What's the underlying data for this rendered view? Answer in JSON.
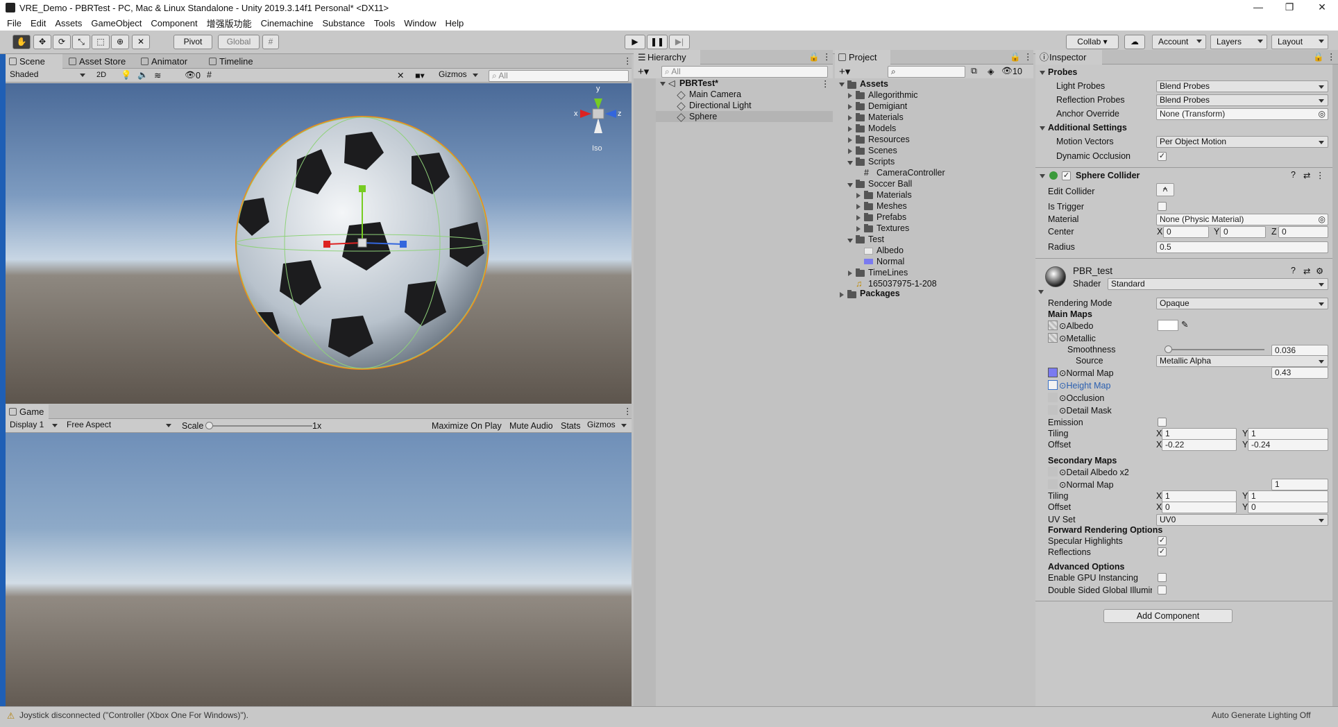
{
  "window": {
    "title": "VRE_Demo - PBRTest - PC, Mac & Linux Standalone - Unity 2019.3.14f1 Personal* <DX11>",
    "minimize": "—",
    "maximize": "❐",
    "close": "✕"
  },
  "menu": [
    "File",
    "Edit",
    "Assets",
    "GameObject",
    "Component",
    "增强版功能",
    "Cinemachine",
    "Substance",
    "Tools",
    "Window",
    "Help"
  ],
  "toolbar": {
    "pivot": "Pivot",
    "global": "Global",
    "collab": "Collab ▾",
    "account": "Account",
    "layers": "Layers",
    "layout": "Layout"
  },
  "scene": {
    "tabs": [
      "Scene",
      "Asset Store",
      "Animator",
      "Timeline"
    ],
    "shading": "Shaded",
    "mode2d": "2D",
    "gizmos": "Gizmos",
    "search_placeholder": "All",
    "hidden_count": "0",
    "axis_y": "y",
    "axis_x": "x",
    "axis_z": "z",
    "iso": "Iso"
  },
  "game": {
    "tab": "Game",
    "display": "Display 1",
    "aspect": "Free Aspect",
    "scale_label": "Scale",
    "scale_value": "1x",
    "maximize": "Maximize On Play",
    "mute": "Mute Audio",
    "stats": "Stats",
    "gizmos": "Gizmos"
  },
  "hierarchy": {
    "tab": "Hierarchy",
    "search_placeholder": "All",
    "scene": "PBRTest*",
    "items": [
      "Main Camera",
      "Directional Light",
      "Sphere"
    ]
  },
  "project": {
    "tab": "Project",
    "count": "10",
    "root": "Assets",
    "items": [
      {
        "label": "Allegorithmic",
        "depth": 1,
        "kind": "folder",
        "arrow": "right"
      },
      {
        "label": "Demigiant",
        "depth": 1,
        "kind": "folder",
        "arrow": "right"
      },
      {
        "label": "Materials",
        "depth": 1,
        "kind": "folder",
        "arrow": "right"
      },
      {
        "label": "Models",
        "depth": 1,
        "kind": "folder",
        "arrow": "right"
      },
      {
        "label": "Resources",
        "depth": 1,
        "kind": "folder",
        "arrow": "right"
      },
      {
        "label": "Scenes",
        "depth": 1,
        "kind": "folder",
        "arrow": "right"
      },
      {
        "label": "Scripts",
        "depth": 1,
        "kind": "folder",
        "arrow": "down"
      },
      {
        "label": "CameraController",
        "depth": 2,
        "kind": "script",
        "arrow": ""
      },
      {
        "label": "Soccer Ball",
        "depth": 1,
        "kind": "folder",
        "arrow": "down"
      },
      {
        "label": "Materials",
        "depth": 2,
        "kind": "folder",
        "arrow": "right"
      },
      {
        "label": "Meshes",
        "depth": 2,
        "kind": "folder",
        "arrow": "right"
      },
      {
        "label": "Prefabs",
        "depth": 2,
        "kind": "folder",
        "arrow": "right"
      },
      {
        "label": "Textures",
        "depth": 2,
        "kind": "folder",
        "arrow": "right"
      },
      {
        "label": "Test",
        "depth": 1,
        "kind": "folder",
        "arrow": "down"
      },
      {
        "label": "Albedo",
        "depth": 2,
        "kind": "texture",
        "arrow": ""
      },
      {
        "label": "Normal",
        "depth": 2,
        "kind": "normal",
        "arrow": ""
      },
      {
        "label": "TimeLines",
        "depth": 1,
        "kind": "folder",
        "arrow": "right"
      },
      {
        "label": "165037975-1-208",
        "depth": 1,
        "kind": "audio",
        "arrow": ""
      }
    ],
    "packages": "Packages"
  },
  "inspector": {
    "tab": "Inspector",
    "probes": {
      "header": "Probes",
      "light_label": "Light Probes",
      "light_value": "Blend Probes",
      "refl_label": "Reflection Probes",
      "refl_value": "Blend Probes",
      "anchor_label": "Anchor Override",
      "anchor_value": "None (Transform)"
    },
    "additional": {
      "header": "Additional Settings",
      "motion_label": "Motion Vectors",
      "motion_value": "Per Object Motion",
      "occlusion_label": "Dynamic Occlusion"
    },
    "collider": {
      "header": "Sphere Collider",
      "edit_label": "Edit Collider",
      "trigger_label": "Is Trigger",
      "material_label": "Material",
      "material_value": "None (Physic Material)",
      "center_label": "Center",
      "cx": "0",
      "cy": "0",
      "cz": "0",
      "radius_label": "Radius",
      "radius_value": "0.5"
    },
    "material": {
      "name": "PBR_test",
      "shader_label": "Shader",
      "shader_value": "Standard",
      "rendering_label": "Rendering Mode",
      "rendering_value": "Opaque",
      "main_maps": "Main Maps",
      "albedo": "Albedo",
      "metallic": "Metallic",
      "smoothness_label": "Smoothness",
      "smoothness_value": "0.036",
      "smoothness_fraction": 0.036,
      "source_label": "Source",
      "source_value": "Metallic Alpha",
      "normal_label": "Normal Map",
      "normal_value": "0.43",
      "height_label": "Height Map",
      "occlusion_label": "Occlusion",
      "detail_mask_label": "Detail Mask",
      "emission_label": "Emission",
      "tiling_label": "Tiling",
      "tx": "1",
      "ty": "1",
      "offset_label": "Offset",
      "ox": "-0.22",
      "oy": "-0.24",
      "secondary": "Secondary Maps",
      "detail_albedo": "Detail Albedo x2",
      "normal2_label": "Normal Map",
      "normal2_value": "1",
      "tiling2_label": "Tiling",
      "tx2": "1",
      "ty2": "1",
      "offset2_label": "Offset",
      "ox2": "0",
      "oy2": "0",
      "uvset_label": "UV Set",
      "uvset_value": "UV0",
      "forward": "Forward Rendering Options",
      "specular_label": "Specular Highlights",
      "reflections_label": "Reflections",
      "advanced": "Advanced Options",
      "gpu_label": "Enable GPU Instancing",
      "double_label": "Double Sided Global Illumina"
    },
    "add_component": "Add Component"
  },
  "status": {
    "message": "Joystick disconnected (\"Controller (Xbox One For Windows)\").",
    "lighting": "Auto Generate Lighting Off"
  },
  "colors": {
    "accent_blue": "#3a72c8",
    "selection": "#f08a1a",
    "x_axis": "#d22",
    "y_axis": "#7c2",
    "z_axis": "#36d"
  }
}
